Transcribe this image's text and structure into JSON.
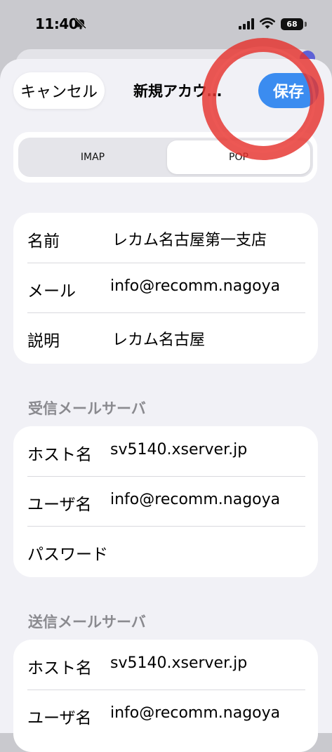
{
  "status_bar": {
    "time": "11:40",
    "battery": "68"
  },
  "header": {
    "cancel_label": "キャンセル",
    "title": "新規アカウ…",
    "save_label": "保存"
  },
  "segments": {
    "imap": "IMAP",
    "pop": "POP",
    "selected": "POP"
  },
  "account": [
    {
      "label": "名前",
      "value": "レカム名古屋第一支店"
    },
    {
      "label": "メール",
      "value": "info@recomm.nagoya"
    },
    {
      "label": "説明",
      "value": "レカム名古屋"
    }
  ],
  "incoming": {
    "header": "受信メールサーバ",
    "rows": [
      {
        "label": "ホスト名",
        "value": "sv5140.xserver.jp"
      },
      {
        "label": "ユーザ名",
        "value": "info@recomm.nagoya"
      },
      {
        "label": "パスワード",
        "value": ""
      }
    ]
  },
  "outgoing": {
    "header": "送信メールサーバ",
    "rows": [
      {
        "label": "ホスト名",
        "value": "sv5140.xserver.jp"
      },
      {
        "label": "ユーザ名",
        "value": "info@recomm.nagoya"
      }
    ]
  },
  "colors": {
    "accent": "#3b8cf0",
    "annotation": "#e5322d",
    "background": "#f1f1f6"
  }
}
